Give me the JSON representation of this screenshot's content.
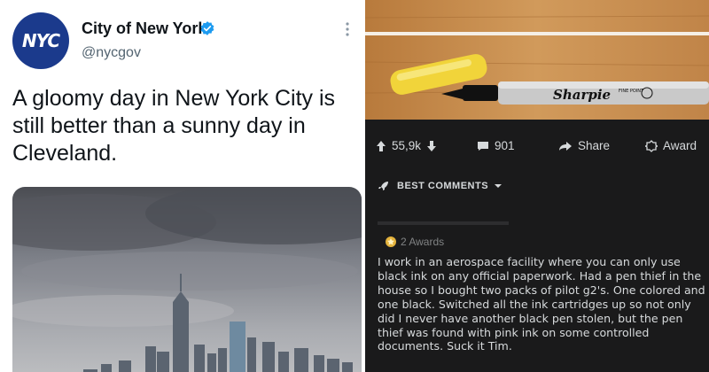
{
  "tweet": {
    "avatar_text": "NYC",
    "display_name": "City of New York",
    "handle": "@nycgov",
    "text": "A gloomy day in New York City is still better than a sunny day in Cleveland.",
    "verified_color": "#1d9bf0",
    "photo_alt": "Cloudy Lower Manhattan skyline"
  },
  "reddit": {
    "post_image_alt": "Yellow cap and black Sharpie fine point marker on a wooden table",
    "marker_brand": "Sharpie",
    "marker_sub": "FINE POINT",
    "actions": {
      "votes": "55,9k",
      "comments": "901",
      "share": "Share",
      "award": "Award"
    },
    "sort_label": "BEST COMMENTS",
    "comment": {
      "awards": "2 Awards",
      "text": "I work in an aerospace facility where you can only use black ink on any official paperwork. Had a pen thief in the house so I bought two packs of pilot g2's. One colored and one black. Switched all the ink cartridges up so not only did I never have another black pen stolen, but the pen thief was found with pink ink on some controlled documents. Suck it Tim."
    }
  },
  "colors": {
    "nyc_blue": "#1b3a8c",
    "reddit_bg": "#1a1a1b",
    "reddit_text": "#d7dadc",
    "muted": "#818384"
  }
}
